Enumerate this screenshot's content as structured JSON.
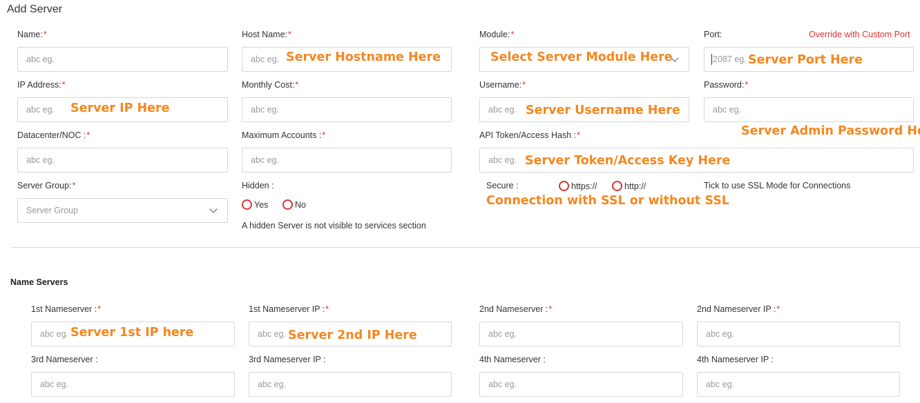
{
  "page": {
    "title": "Add Server"
  },
  "colors": {
    "required": "#e03131",
    "annotation": "#f5871f",
    "border": "#d3d7dc"
  },
  "placeholder": "abc eg.",
  "fields": {
    "name": {
      "label": "Name:",
      "req": "*"
    },
    "host_name": {
      "label": "Host Name:",
      "req": "*",
      "annotation": "Server Hostname Here"
    },
    "module": {
      "label": "Module:",
      "req": "*",
      "annotation": "Select Server Module Here"
    },
    "port": {
      "label": "Port:",
      "placeholder": "2087 eg.",
      "override_link": "Override with Custom Port",
      "annotation": "Server Port Here"
    },
    "ip_address": {
      "label": "IP Address:",
      "req": "*",
      "annotation": "Server IP Here"
    },
    "monthly_cost": {
      "label": "Monthly Cost:",
      "req": "*"
    },
    "username": {
      "label": "Username:",
      "req": "*",
      "annotation": "Server Username Here"
    },
    "password": {
      "label": "Password:",
      "req": "*",
      "annotation": "Server Admin Password Here"
    },
    "datacenter": {
      "label": "Datacenter/NOC :",
      "req": "*"
    },
    "max_accounts": {
      "label": "Maximum Accounts :",
      "req": "*"
    },
    "api_token": {
      "label": "API Token/Access Hash :",
      "req": "*",
      "annotation": "Server Token/Access Key Here"
    },
    "server_group": {
      "label": "Server Group:",
      "req": "*",
      "placeholder": "Server Group"
    },
    "hidden": {
      "label": "Hidden :",
      "yes": "Yes",
      "no": "No",
      "hint": "A hidden Server is not visible to services section"
    },
    "secure": {
      "label": "Secure :",
      "https": "https://",
      "http": "http://",
      "hint": "Tick to use SSL Mode for Connections",
      "annotation": "Connection with SSL or without SSL"
    }
  },
  "nameservers": {
    "section_title": "Name Servers",
    "ns1": {
      "label": "1st Nameserver :",
      "req": "*",
      "annotation": "Server 1st IP here"
    },
    "ns1_ip": {
      "label": "1st Nameserver IP :",
      "req": "*",
      "annotation": "Server 2nd IP Here"
    },
    "ns2": {
      "label": "2nd Nameserver :",
      "req": "*"
    },
    "ns2_ip": {
      "label": "2nd Nameserver IP :",
      "req": "*"
    },
    "ns3": {
      "label": "3rd Nameserver :"
    },
    "ns3_ip": {
      "label": "3rd Nameserver IP :"
    },
    "ns4": {
      "label": "4th Nameserver :"
    },
    "ns4_ip": {
      "label": "4th Nameserver IP :"
    }
  }
}
